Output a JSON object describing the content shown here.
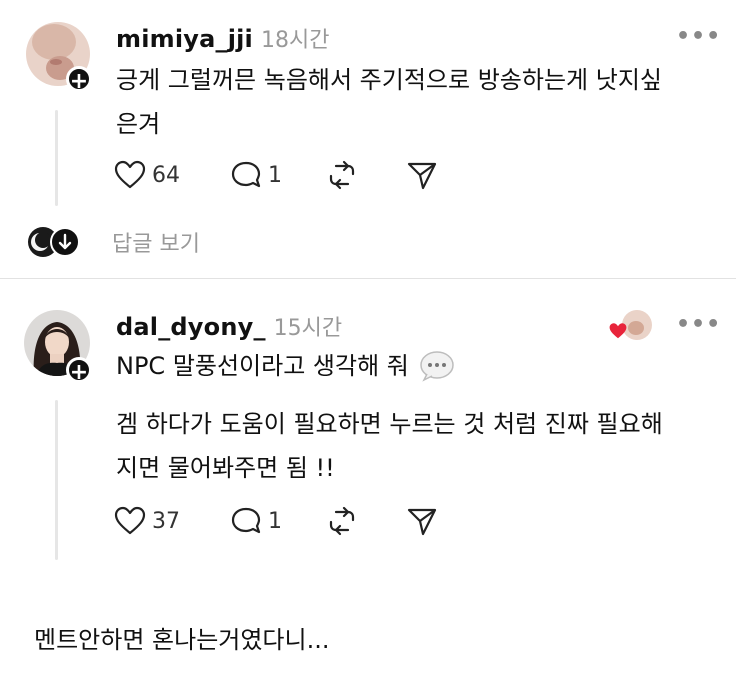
{
  "comments": [
    {
      "username": "mimiya_jji",
      "time": "18시간",
      "text_lines": [
        "긍게 그럴꺼믄 녹음해서 주기적으로 방송하는게 낫지싶",
        "은겨"
      ],
      "likes": "64",
      "replies": "1"
    },
    {
      "username": "dal_dyony_",
      "time": "15시간",
      "text_line1": "NPC 말풍선이라고 생각해 줘",
      "text_line2": [
        "겜 하다가 도움이 필요하면 누르는 것 처럼 진짜 필요해",
        "지면 물어봐주면 됨 !!"
      ],
      "likes": "37",
      "replies": "1"
    }
  ],
  "view_replies_label": "답글 보기",
  "more_label": "•••",
  "footer_text": "멘트안하면 혼나는거였다니...",
  "colors": {
    "text": "#111111",
    "muted": "#999999",
    "divider": "#e2e2e2",
    "heart": "#e8243b"
  }
}
